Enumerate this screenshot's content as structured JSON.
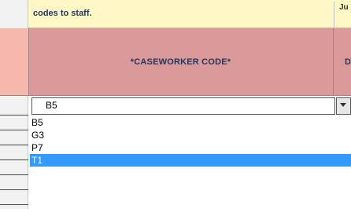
{
  "sheet": {
    "instruction_text": "codes to staff.",
    "cut_off_header": "Ju"
  },
  "header": {
    "column_label": "*CASEWORKER CODE*",
    "next_column_partial": "D"
  },
  "dropdown": {
    "selected_value": "B5",
    "arrow_icon": "chevron-down-icon",
    "options": [
      "B5",
      "G3",
      "P7",
      "T1"
    ],
    "highlighted_option": "T1"
  },
  "colors": {
    "header_fill": "#d99a99",
    "instruction_fill": "#fff8c6",
    "highlight": "#3399ff"
  }
}
